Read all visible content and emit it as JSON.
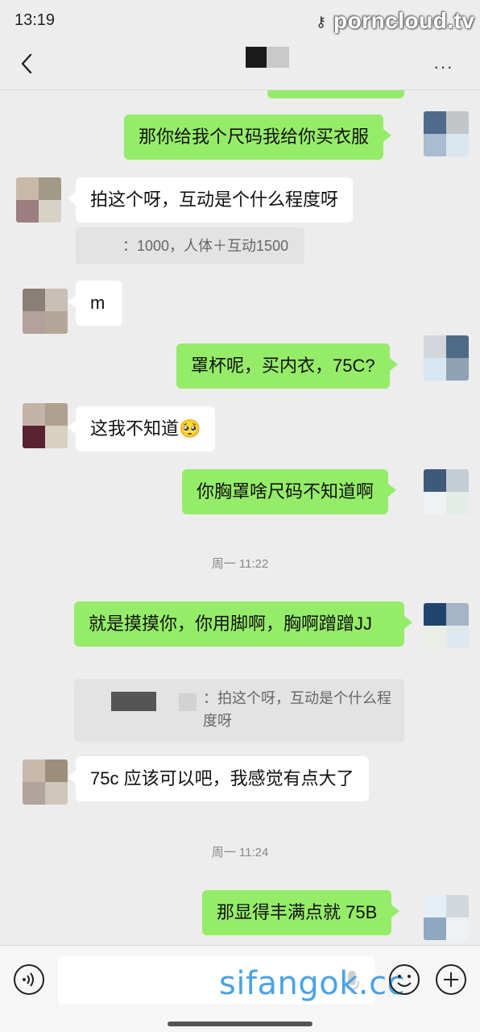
{
  "status": {
    "time": "13:19",
    "key_glyph": "⚷",
    "watermark": "porncloud.tv"
  },
  "header": {
    "back_glyph": "‹",
    "more_glyph": "···"
  },
  "messages": [
    {
      "dir": "out",
      "text": "那你给我个尺码我给你买衣服"
    },
    {
      "dir": "in",
      "text": "拍这个呀，互动是个什么程度呀"
    },
    {
      "quote_text": "：1000，人体＋互动1500"
    },
    {
      "dir": "in",
      "text": "m"
    },
    {
      "dir": "out",
      "text": "罩杯呢，买内衣，75C?"
    },
    {
      "dir": "in",
      "text": "这我不知道🥺"
    },
    {
      "dir": "out",
      "text": "你胸罩啥尺码不知道啊"
    },
    {
      "time": "周一 11:22"
    },
    {
      "dir": "out",
      "text": "就是摸摸你，你用脚啊，胸啊蹭蹭JJ"
    },
    {
      "quote_text": "：拍这个呀，互动是个什么程度呀"
    },
    {
      "dir": "in",
      "text": "75c 应该可以吧，我感觉有点大了"
    },
    {
      "time": "周一 11:24"
    },
    {
      "dir": "out",
      "text": "那显得丰满点就 75B"
    }
  ],
  "input": {
    "placeholder": "",
    "watermark": "sifangok.cc"
  },
  "colors": {
    "out_bubble": "#95ec69",
    "in_bubble": "#ffffff",
    "background": "#ededed"
  }
}
